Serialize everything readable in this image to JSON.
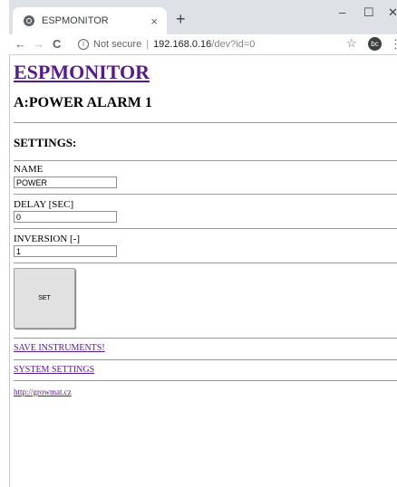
{
  "browser": {
    "tab_title": "ESPMONITOR",
    "tab_close": "×",
    "new_tab": "+",
    "window_controls": {
      "minimize": "–",
      "maximize": "☐",
      "close": "✕"
    },
    "nav": {
      "back": "←",
      "forward": "→",
      "reload": "C"
    },
    "address": {
      "security_label": "Not secure",
      "separator": "|",
      "host": "192.168.0.16",
      "path": "/dev?id=0"
    },
    "star": "☆",
    "profile_initials": "bc",
    "menu": "⋮"
  },
  "page": {
    "brand": "ESPMONITOR",
    "heading": "A:POWER ALARM 1",
    "settings_title": "SETTINGS:",
    "fields": [
      {
        "label": "NAME",
        "value": "POWER"
      },
      {
        "label": "DELAY [SEC]",
        "value": "0"
      },
      {
        "label": "INVERSION [-]",
        "value": "1"
      }
    ],
    "set_button": "SET",
    "links": {
      "save": "SAVE INSTRUMENTS!",
      "system": "SYSTEM SETTINGS",
      "website": "http://growmat.cz"
    }
  }
}
